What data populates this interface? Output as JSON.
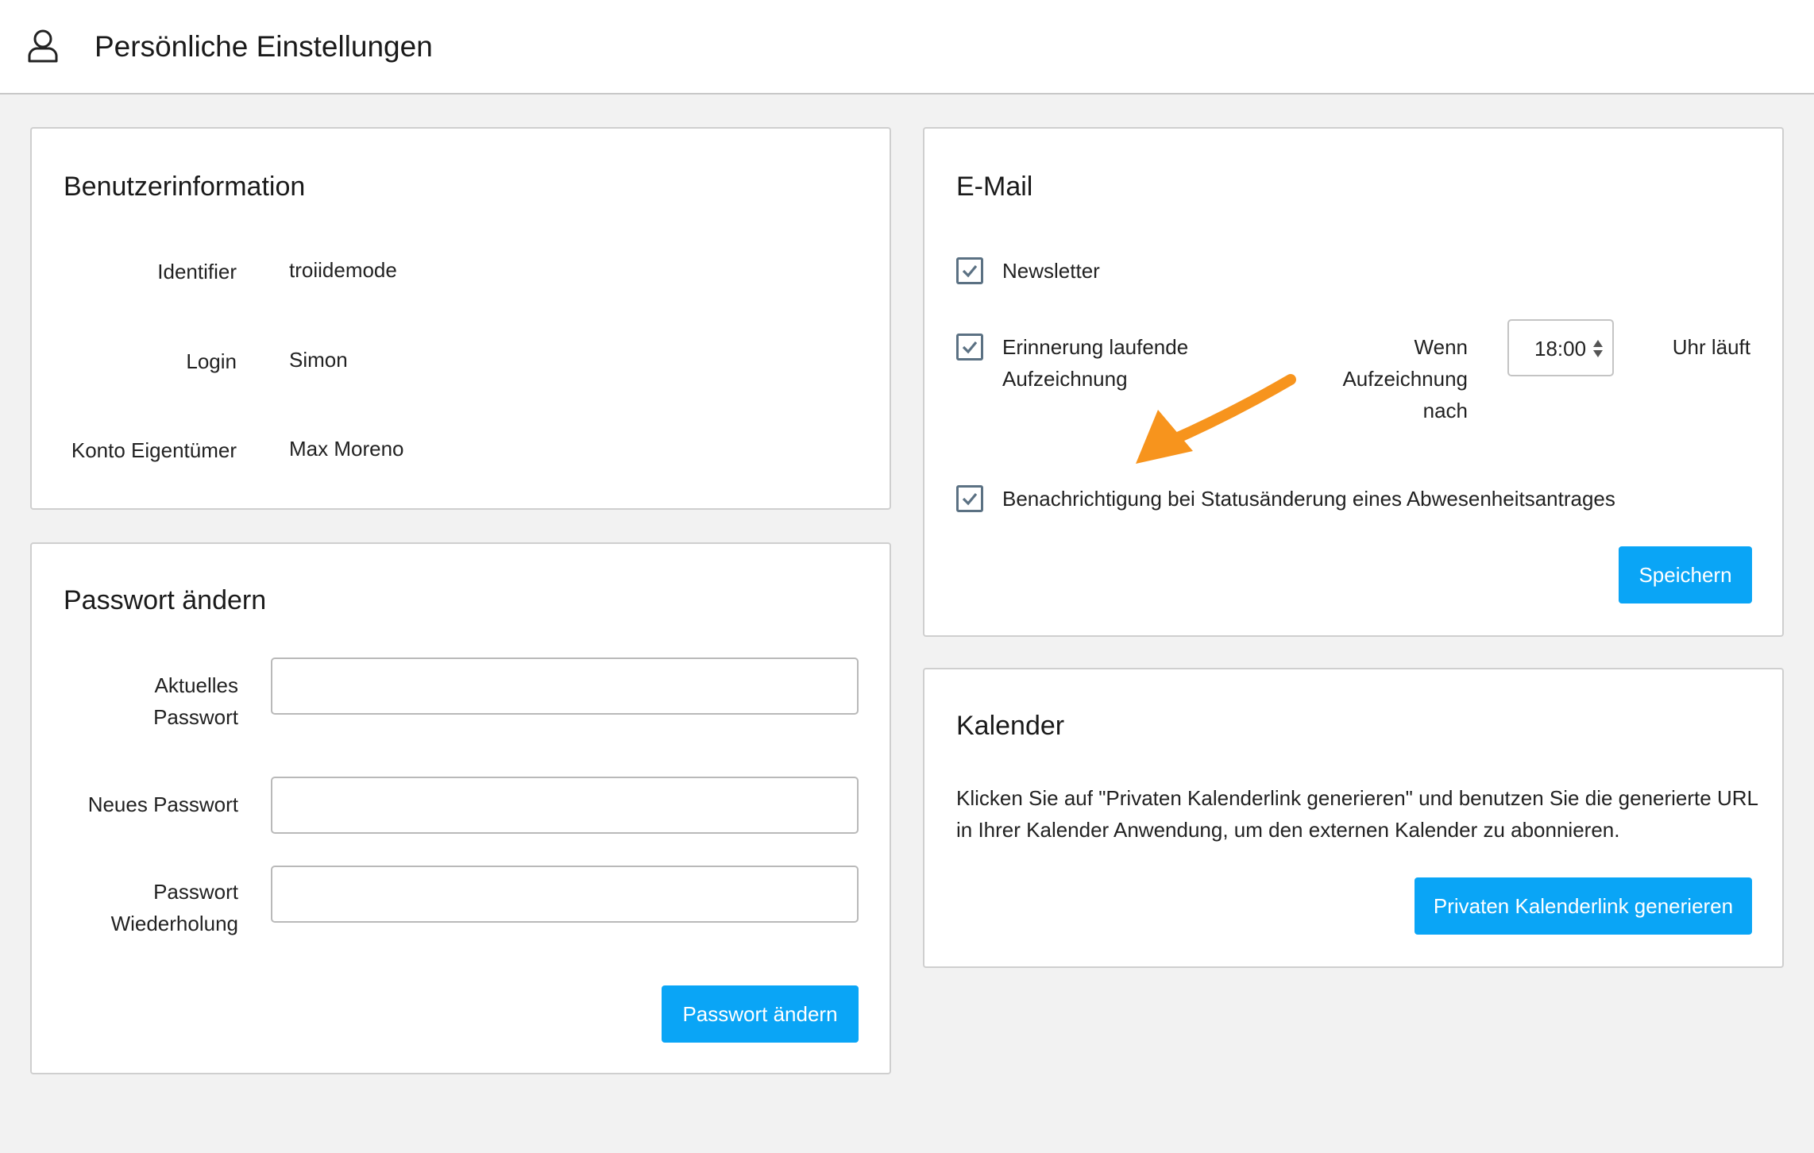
{
  "header": {
    "title": "Persönliche Einstellungen",
    "icon": "user-icon"
  },
  "user_info": {
    "title": "Benutzerinformation",
    "rows": [
      {
        "label": "Identifier",
        "value": "troiidemode"
      },
      {
        "label": "Login",
        "value": "Simon"
      },
      {
        "label": "Konto Eigentümer",
        "value": "Max Moreno"
      }
    ]
  },
  "password": {
    "title": "Passwort ändern",
    "current_label_line1": "Aktuelles",
    "current_label_line2": "Passwort",
    "new_label": "Neues Passwort",
    "repeat_label_line1": "Passwort",
    "repeat_label_line2": "Wiederholung",
    "current_value": "",
    "new_value": "",
    "repeat_value": "",
    "submit_label": "Passwort ändern"
  },
  "email": {
    "title": "E-Mail",
    "newsletter_label": "Newsletter",
    "newsletter_checked": true,
    "reminder_label_line1": "Erinnerung laufende",
    "reminder_label_line2": "Aufzeichnung",
    "reminder_checked": true,
    "when_line1": "Wenn",
    "when_line2": "Aufzeichnung",
    "when_line3": "nach",
    "time_value": "18:00",
    "suffix": "Uhr läuft",
    "absence_label": "Benachrichtigung bei Statusänderung eines Abwesenheitsantrages",
    "absence_checked": true,
    "save_label": "Speichern"
  },
  "calendar": {
    "title": "Kalender",
    "text_line1": "Klicken Sie auf \"Privaten Kalenderlink generieren\" und benutzen Sie die generierte URL",
    "text_line2": "in Ihrer Kalender Anwendung, um den externen Kalender zu abonnieren.",
    "button_label": "Privaten Kalenderlink generieren"
  },
  "colors": {
    "accent": "#0aa5f6",
    "checkbox_border": "#5b7183",
    "annotation_arrow": "#f7941d"
  }
}
